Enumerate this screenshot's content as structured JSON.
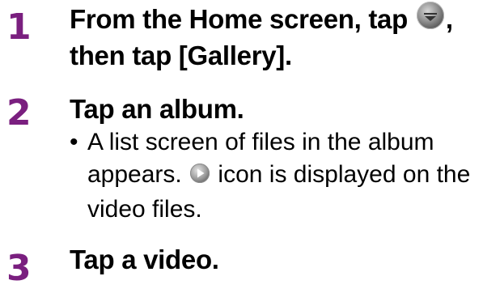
{
  "colors": {
    "step_number": "#7a1f7f",
    "text": "#000000"
  },
  "steps": [
    {
      "number": "1",
      "title_line1_before": "From the Home screen, tap ",
      "title_line1_icon": "app-drawer-icon",
      "title_line1_after": ",",
      "title_line2": "then tap [Gallery]."
    },
    {
      "number": "2",
      "title": "Tap an album.",
      "bullet": "•",
      "body_line1": "A list screen of files in the album",
      "body_line2_before": "appears. ",
      "body_line2_icon": "video-play-icon",
      "body_line2_after": " icon is displayed on the",
      "body_line3": "video files."
    },
    {
      "number": "3",
      "title": "Tap a video."
    }
  ]
}
